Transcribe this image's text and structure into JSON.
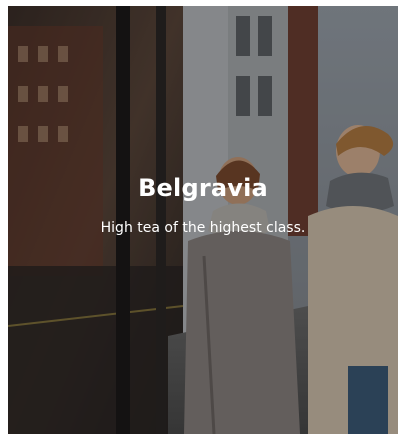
{
  "card": {
    "title": "Belgravia",
    "subtitle": "High tea of the highest class."
  }
}
